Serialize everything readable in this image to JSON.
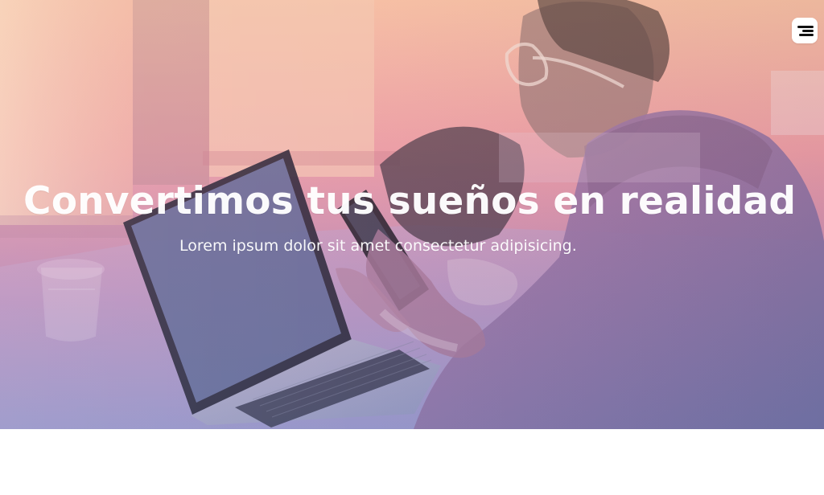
{
  "hero": {
    "title": "Convertimos tus sueños en realidad",
    "subtitle": "Lorem ipsum dolor sit amet consectetur adipisicing.",
    "menu_icon": "hamburger-menu-icon"
  },
  "colors": {
    "overlay_top": "#f2b7a6",
    "overlay_mid": "#e69aa8",
    "overlay_low": "#b785b4",
    "overlay_bottom": "#8b8ec2",
    "text": "#ffffff",
    "menu_button": "#ffffff"
  }
}
